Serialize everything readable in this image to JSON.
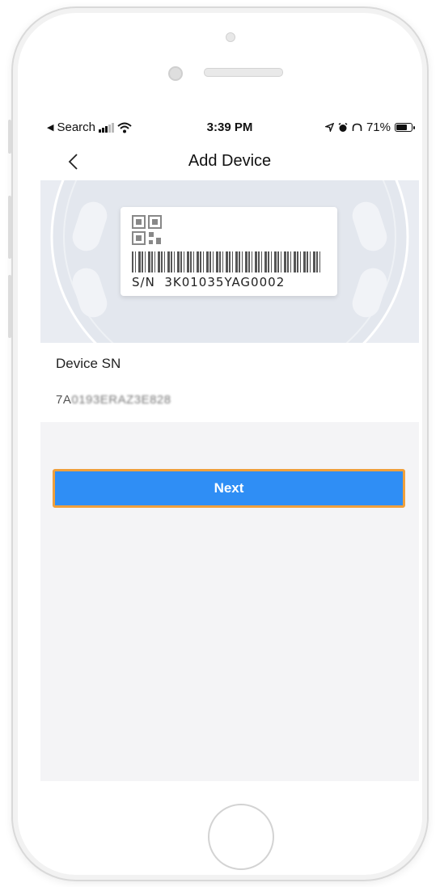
{
  "status_bar": {
    "back_app": "Search",
    "time": "3:39 PM",
    "battery": "71%",
    "battery_level": 0.71
  },
  "nav": {
    "title": "Add Device"
  },
  "hero": {
    "sn_prefix": "S/N",
    "sn_value": "3K01035YAG0002"
  },
  "device_sn": {
    "label": "Device SN",
    "value_visible": "7A",
    "value_obscured": "0193ERAZ3E828"
  },
  "actions": {
    "next_label": "Next"
  },
  "colors": {
    "primary": "#2f8ef5",
    "highlight_border": "#f0a03c"
  }
}
